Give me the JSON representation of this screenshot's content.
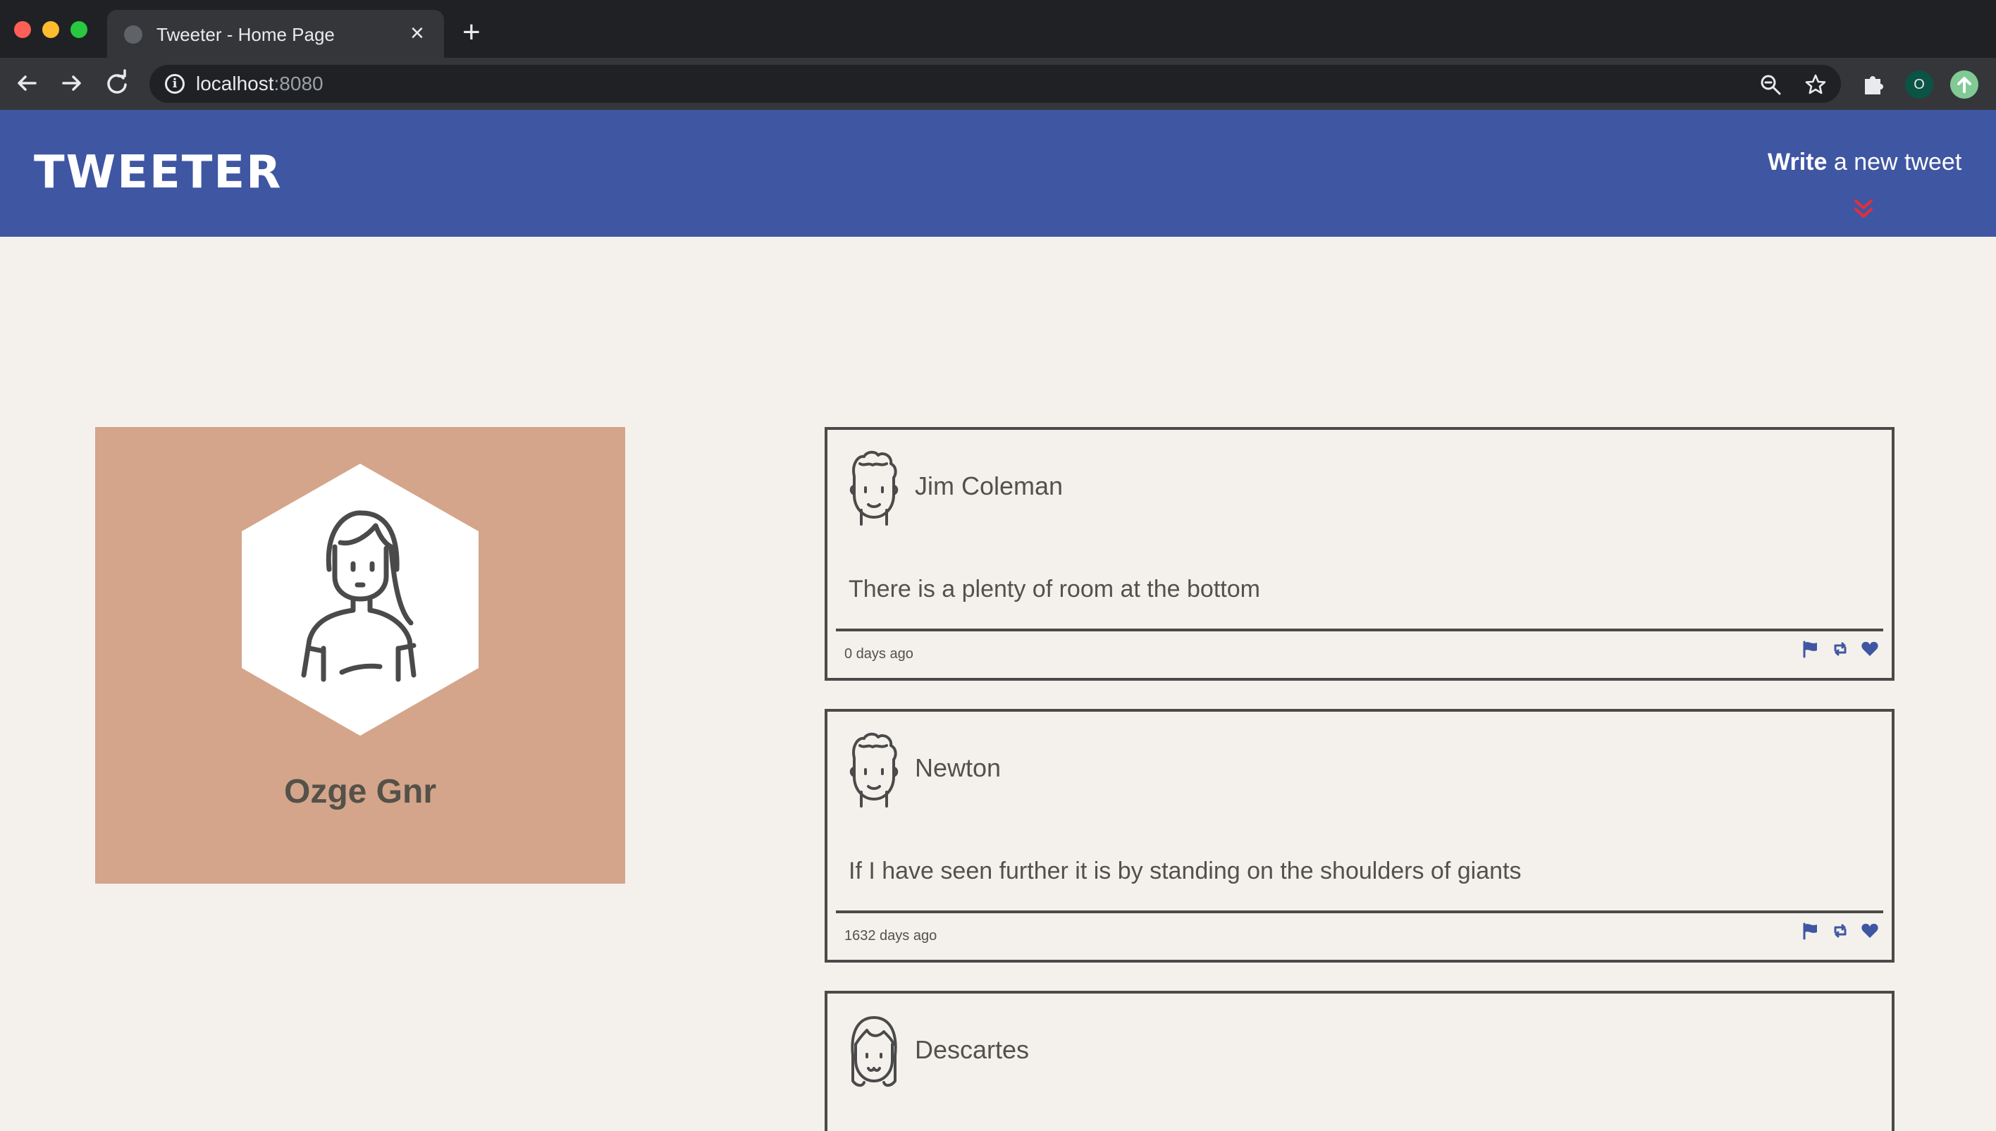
{
  "browser": {
    "tab_title": "Tweeter - Home Page",
    "close_glyph": "×",
    "new_tab_glyph": "+",
    "url_host": "localhost",
    "url_port": ":8080",
    "profile_initial": "O"
  },
  "header": {
    "logo": "TWEETER",
    "compose_bold": "Write",
    "compose_rest": " a new tweet",
    "accent_color": "#e0303a",
    "background_color": "#3f56a2"
  },
  "profile": {
    "name": "Ozge Gnr",
    "card_color": "#d4a58a"
  },
  "tweets": [
    {
      "author": "Jim Coleman",
      "text": "There is a plenty of room at the bottom",
      "time": "0 days ago",
      "avatar": "curly-hair-avatar"
    },
    {
      "author": "Newton",
      "text": "If I have seen further it is by standing on the shoulders of giants",
      "time": "1632 days ago",
      "avatar": "curly-hair-avatar"
    },
    {
      "author": "Descartes",
      "text": "",
      "time": "",
      "avatar": "bangs-avatar"
    }
  ]
}
